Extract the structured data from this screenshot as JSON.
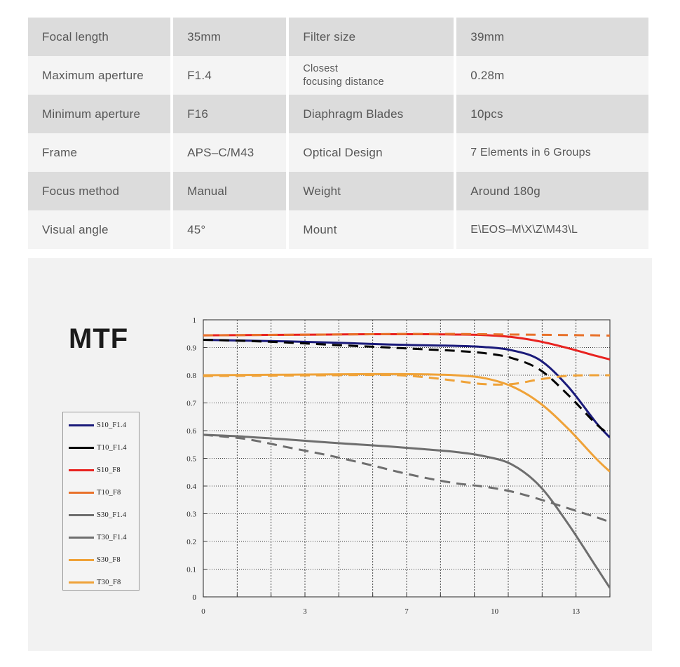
{
  "spec_table": {
    "rows": [
      {
        "shade": "dark",
        "label_a": "Focal length",
        "value_a": "35mm",
        "label_b": "Filter size",
        "value_b": "39mm"
      },
      {
        "shade": "light",
        "label_a": "Maximum aperture",
        "value_a": "F1.4",
        "label_b": "Closest\nfocusing distance",
        "value_b": "0.28m"
      },
      {
        "shade": "dark",
        "label_a": "Minimum aperture",
        "value_a": "F16",
        "label_b": "Diaphragm Blades",
        "value_b": "10pcs"
      },
      {
        "shade": "light",
        "label_a": "Frame",
        "value_a": "APS–C/M43",
        "label_b": "Optical Design",
        "value_b": "7 Elements in 6 Groups"
      },
      {
        "shade": "dark",
        "label_a": "Focus method",
        "value_a": "Manual",
        "label_b": "Weight",
        "value_b": "Around 180g"
      },
      {
        "shade": "light",
        "label_a": "Visual angle",
        "value_a": "45°",
        "label_b": "Mount",
        "value_b": "E\\EOS–M\\X\\Z\\M43\\L"
      }
    ]
  },
  "chart": {
    "title": "MTF",
    "legend": [
      {
        "label": "S10_F1.4",
        "color": "#1a1a7a",
        "dash": "solid"
      },
      {
        "label": "T10_F1.4",
        "color": "#000000",
        "dash": "solid"
      },
      {
        "label": "S10_F8",
        "color": "#e8221f",
        "dash": "solid"
      },
      {
        "label": "T10_F8",
        "color": "#e8712a",
        "dash": "solid"
      },
      {
        "label": "S30_F1.4",
        "color": "#6e6e6e",
        "dash": "solid"
      },
      {
        "label": "T30_F1.4",
        "color": "#6e6e6e",
        "dash": "solid"
      },
      {
        "label": "S30_F8",
        "color": "#efa238",
        "dash": "solid"
      },
      {
        "label": "T30_F8",
        "color": "#efa238",
        "dash": "solid"
      }
    ]
  },
  "chart_data": {
    "type": "line",
    "title": "MTF",
    "xlabel": "",
    "ylabel": "",
    "xlim": [
      0,
      14.5
    ],
    "ylim": [
      0,
      1
    ],
    "grid": true,
    "legend_position": "left",
    "yticks": [
      "0",
      "0.1",
      "0.2",
      "0.3",
      "0.4",
      "0.5",
      "0.6",
      "0.7",
      "0.8",
      "0.9",
      "1"
    ],
    "xticks": [
      "0",
      "3",
      "7",
      "10",
      "13"
    ],
    "xtick_values": [
      0,
      3,
      7,
      10,
      13
    ],
    "x": [
      0,
      1.5,
      3,
      4.5,
      6,
      7,
      8,
      9,
      10,
      11,
      12,
      13,
      14,
      14.5
    ],
    "series": [
      {
        "name": "S10_F1.4",
        "color": "#1a1a7a",
        "style": "solid",
        "values": [
          0.928,
          0.925,
          0.922,
          0.918,
          0.913,
          0.91,
          0.908,
          0.906,
          0.902,
          0.89,
          0.855,
          0.76,
          0.63,
          0.575
        ]
      },
      {
        "name": "T10_F1.4",
        "color": "#000000",
        "style": "dashed",
        "values": [
          0.928,
          0.924,
          0.918,
          0.91,
          0.903,
          0.898,
          0.893,
          0.888,
          0.88,
          0.862,
          0.82,
          0.73,
          0.625,
          0.585
        ]
      },
      {
        "name": "S10_F8",
        "color": "#e8221f",
        "style": "solid",
        "values": [
          0.944,
          0.945,
          0.946,
          0.947,
          0.948,
          0.948,
          0.948,
          0.947,
          0.945,
          0.938,
          0.922,
          0.898,
          0.87,
          0.857
        ]
      },
      {
        "name": "T10_F8",
        "color": "#e8712a",
        "style": "dashed",
        "values": [
          0.944,
          0.945,
          0.946,
          0.947,
          0.948,
          0.949,
          0.949,
          0.949,
          0.948,
          0.947,
          0.946,
          0.945,
          0.944,
          0.943
        ]
      },
      {
        "name": "S30_F1.4",
        "color": "#6e6e6e",
        "style": "solid",
        "values": [
          0.585,
          0.578,
          0.568,
          0.557,
          0.547,
          0.54,
          0.532,
          0.523,
          0.508,
          0.478,
          0.4,
          0.265,
          0.11,
          0.032
        ]
      },
      {
        "name": "T30_F1.4",
        "color": "#6e6e6e",
        "style": "dashed",
        "values": [
          0.585,
          0.57,
          0.54,
          0.51,
          0.475,
          0.45,
          0.428,
          0.41,
          0.398,
          0.38,
          0.352,
          0.32,
          0.288,
          0.27
        ]
      },
      {
        "name": "S30_F8",
        "color": "#efa238",
        "style": "solid",
        "values": [
          0.8,
          0.801,
          0.802,
          0.803,
          0.804,
          0.804,
          0.803,
          0.8,
          0.79,
          0.76,
          0.7,
          0.608,
          0.5,
          0.452
        ]
      },
      {
        "name": "T30_F8",
        "color": "#efa238",
        "style": "dashed",
        "values": [
          0.797,
          0.798,
          0.799,
          0.8,
          0.801,
          0.8,
          0.792,
          0.78,
          0.768,
          0.768,
          0.785,
          0.798,
          0.8,
          0.8
        ]
      }
    ]
  }
}
